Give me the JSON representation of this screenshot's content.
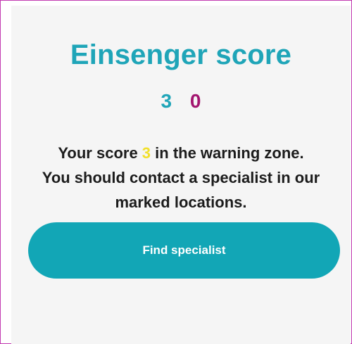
{
  "title": "Einsenger score",
  "scores": {
    "primary": "3",
    "secondary": "0"
  },
  "message": {
    "line1_prefix": "Your score ",
    "line1_score": "3",
    "line1_suffix": " in the warning zone.",
    "line2": "You should contact a specialist in our",
    "line3": "marked locations."
  },
  "button": {
    "label": "Find specialist"
  },
  "colors": {
    "accent": "#1fa5b8",
    "secondary_score": "#a3156f",
    "highlight": "#f2e02b",
    "button": "#12a6b6",
    "frame_border": "#c23bb2"
  }
}
